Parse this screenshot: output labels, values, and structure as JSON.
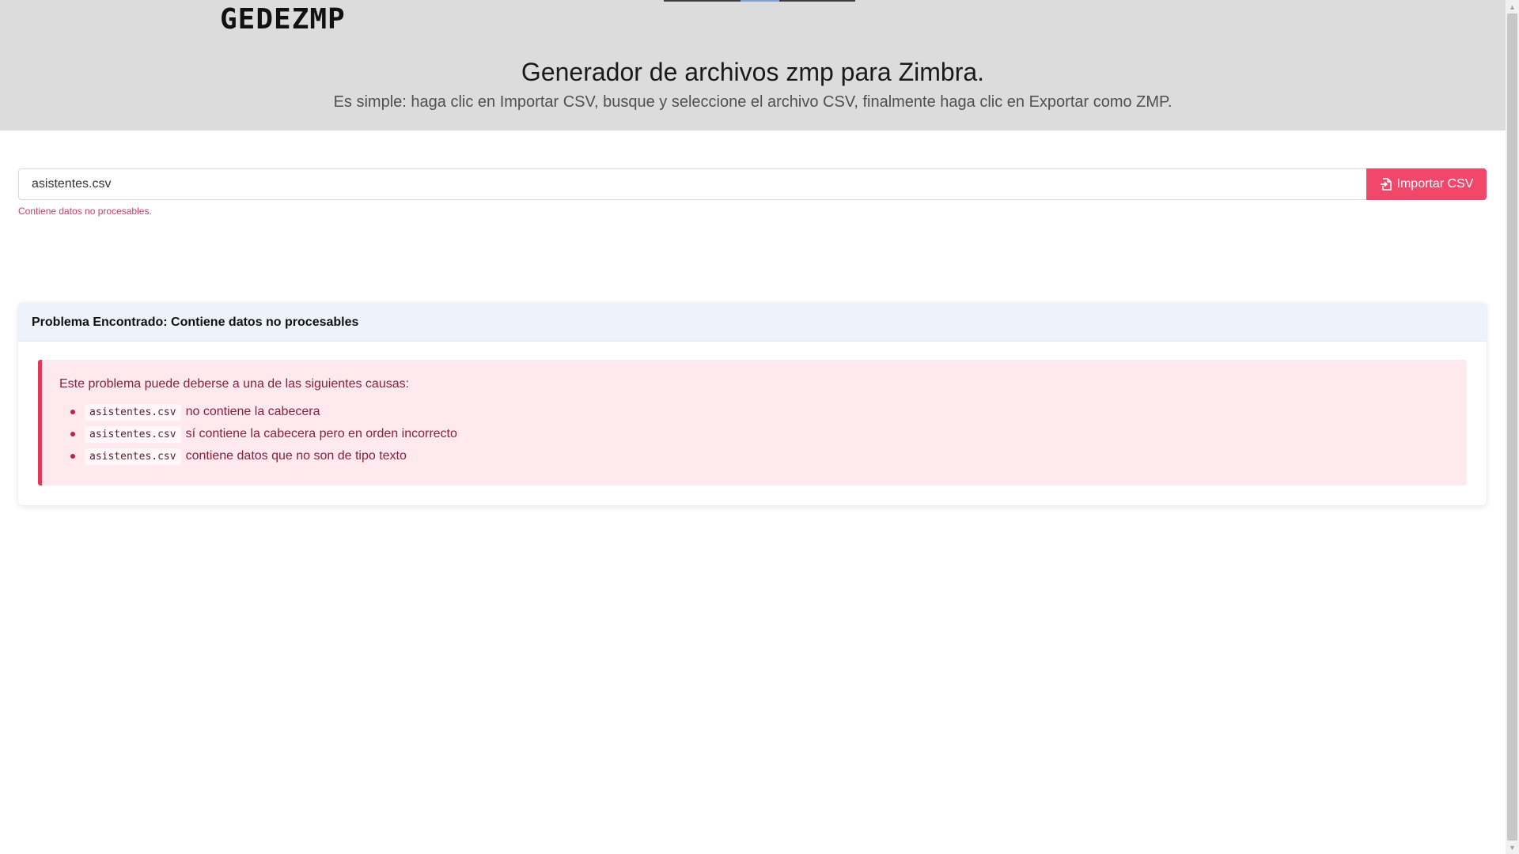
{
  "header": {
    "brand": "GEDEZMP",
    "title": "Generador de archivos zmp para Zimbra.",
    "subtitle": "Es simple: haga clic en Importar CSV, busque y seleccione el archivo CSV, finalmente haga clic en Exportar como ZMP."
  },
  "form": {
    "file_value": "asistentes.csv",
    "import_label": "Importar CSV",
    "import_icon": "file-import-icon",
    "help_text": "Contiene datos no procesables."
  },
  "card": {
    "header": "Problema Encontrado: Contiene datos no procesables",
    "intro": "Este problema puede deberse a una de las siguientes causas:",
    "causes": [
      {
        "file": "asistentes.csv",
        "text": "no contiene la cabecera"
      },
      {
        "file": "asistentes.csv",
        "text": "sí contiene la cabecera pero en orden incorrecto"
      },
      {
        "file": "asistentes.csv",
        "text": "contiene datos que no son de tipo texto"
      }
    ]
  },
  "colors": {
    "hero_bg": "#dcdcdc",
    "accent": "#f0476b",
    "alert_bg": "#fde9ee",
    "alert_text": "#8a1f3c",
    "card_header_bg": "#eef2fa"
  }
}
